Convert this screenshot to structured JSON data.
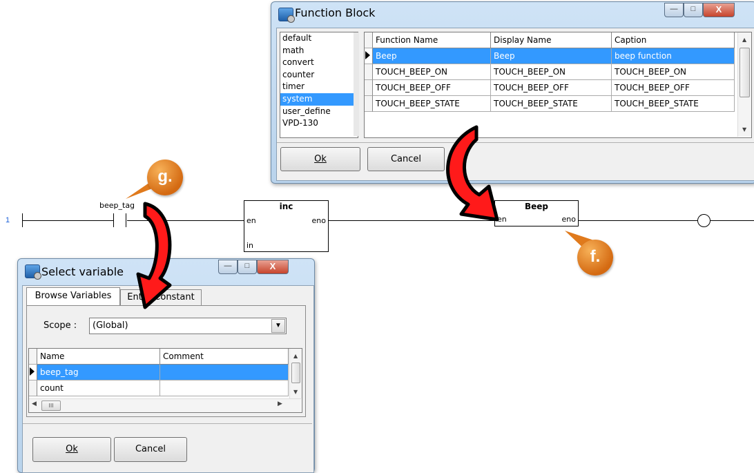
{
  "ladder": {
    "rung_number": "1",
    "contact_label": "beep_tag",
    "inc_block": {
      "title": "inc",
      "pin_en": "en",
      "pin_eno": "eno",
      "pin_in": "in"
    },
    "beep_block": {
      "title": "Beep",
      "pin_en": "en",
      "pin_eno": "eno"
    }
  },
  "callouts": {
    "g": "g.",
    "f": "f."
  },
  "function_block_dialog": {
    "title": "Function Block",
    "categories": [
      "default",
      "math",
      "convert",
      "counter",
      "timer",
      "system",
      "user_define",
      "VPD-130"
    ],
    "selected_category": "system",
    "columns": [
      "Function Name",
      "Display Name",
      "Caption"
    ],
    "rows": [
      [
        "Beep",
        "Beep",
        "beep function"
      ],
      [
        "TOUCH_BEEP_ON",
        "TOUCH_BEEP_ON",
        "TOUCH_BEEP_ON"
      ],
      [
        "TOUCH_BEEP_OFF",
        "TOUCH_BEEP_OFF",
        "TOUCH_BEEP_OFF"
      ],
      [
        "TOUCH_BEEP_STATE",
        "TOUCH_BEEP_STATE",
        "TOUCH_BEEP_STATE"
      ]
    ],
    "ok_label": "Ok",
    "cancel_label": "Cancel"
  },
  "select_variable_dialog": {
    "title": "Select variable",
    "tabs": [
      "Browse Variables",
      "Enter Constant"
    ],
    "scope_label": "Scope :",
    "scope_value": "(Global)",
    "columns": [
      "Name",
      "Comment"
    ],
    "rows": [
      [
        "beep_tag",
        ""
      ],
      [
        "count",
        ""
      ]
    ],
    "hscroll_grip": "III",
    "ok_label": "Ok",
    "cancel_label": "Cancel"
  },
  "colors": {
    "selection": "#3399ff",
    "callout": "#e07a1c",
    "arrow": "#ff0000",
    "rung_number": "#1a5fd8"
  },
  "icons": [
    "function-block-app-icon",
    "select-variable-app-icon",
    "minimize-icon",
    "maximize-icon",
    "close-icon",
    "dropdown-arrow-icon",
    "curved-arrow-icon",
    "coil-icon",
    "contact-icon"
  ]
}
